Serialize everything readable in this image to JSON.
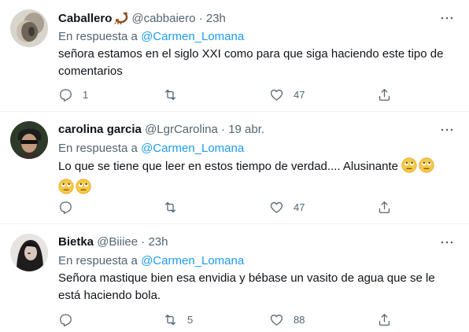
{
  "colors": {
    "text": "#0f1419",
    "secondary": "#536471",
    "link": "#1d9bf0",
    "divider": "#eff3f4"
  },
  "tweets": [
    {
      "name": "Caballero",
      "name_icon": "scorpion-emoji-icon",
      "handle": "@cabbaiero",
      "dot": "·",
      "time": "23h",
      "reply_prefix": "En respuesta a",
      "reply_mention": "@Carmen_Lomana",
      "text": "señora estamos en el siglo XXI como para que siga haciendo este tipo de comentarios",
      "reply_count": "1",
      "retweet_count": "",
      "like_count": "47"
    },
    {
      "name": "carolina garcia",
      "handle": "@LgrCarolina",
      "dot": "·",
      "time": "19 abr.",
      "reply_prefix": "En respuesta a",
      "reply_mention": "@Carmen_Lomana",
      "text": "Lo que se tiene que leer en estos tiempo de verdad.... Alusinante",
      "emojis": [
        "eye-roll-emoji-icon",
        "eye-roll-emoji-icon",
        "eye-roll-emoji-icon",
        "eye-roll-emoji-icon"
      ],
      "reply_count": "",
      "retweet_count": "",
      "like_count": "47"
    },
    {
      "name": "Bietka",
      "handle": "@Biiiee",
      "dot": "·",
      "time": "23h",
      "reply_prefix": "En respuesta a",
      "reply_mention": "@Carmen_Lomana",
      "text": "Señora mastique bien esa envidia y bébase un vasito de agua que se le está haciendo bola.",
      "reply_count": "",
      "retweet_count": "5",
      "like_count": "88"
    }
  ]
}
